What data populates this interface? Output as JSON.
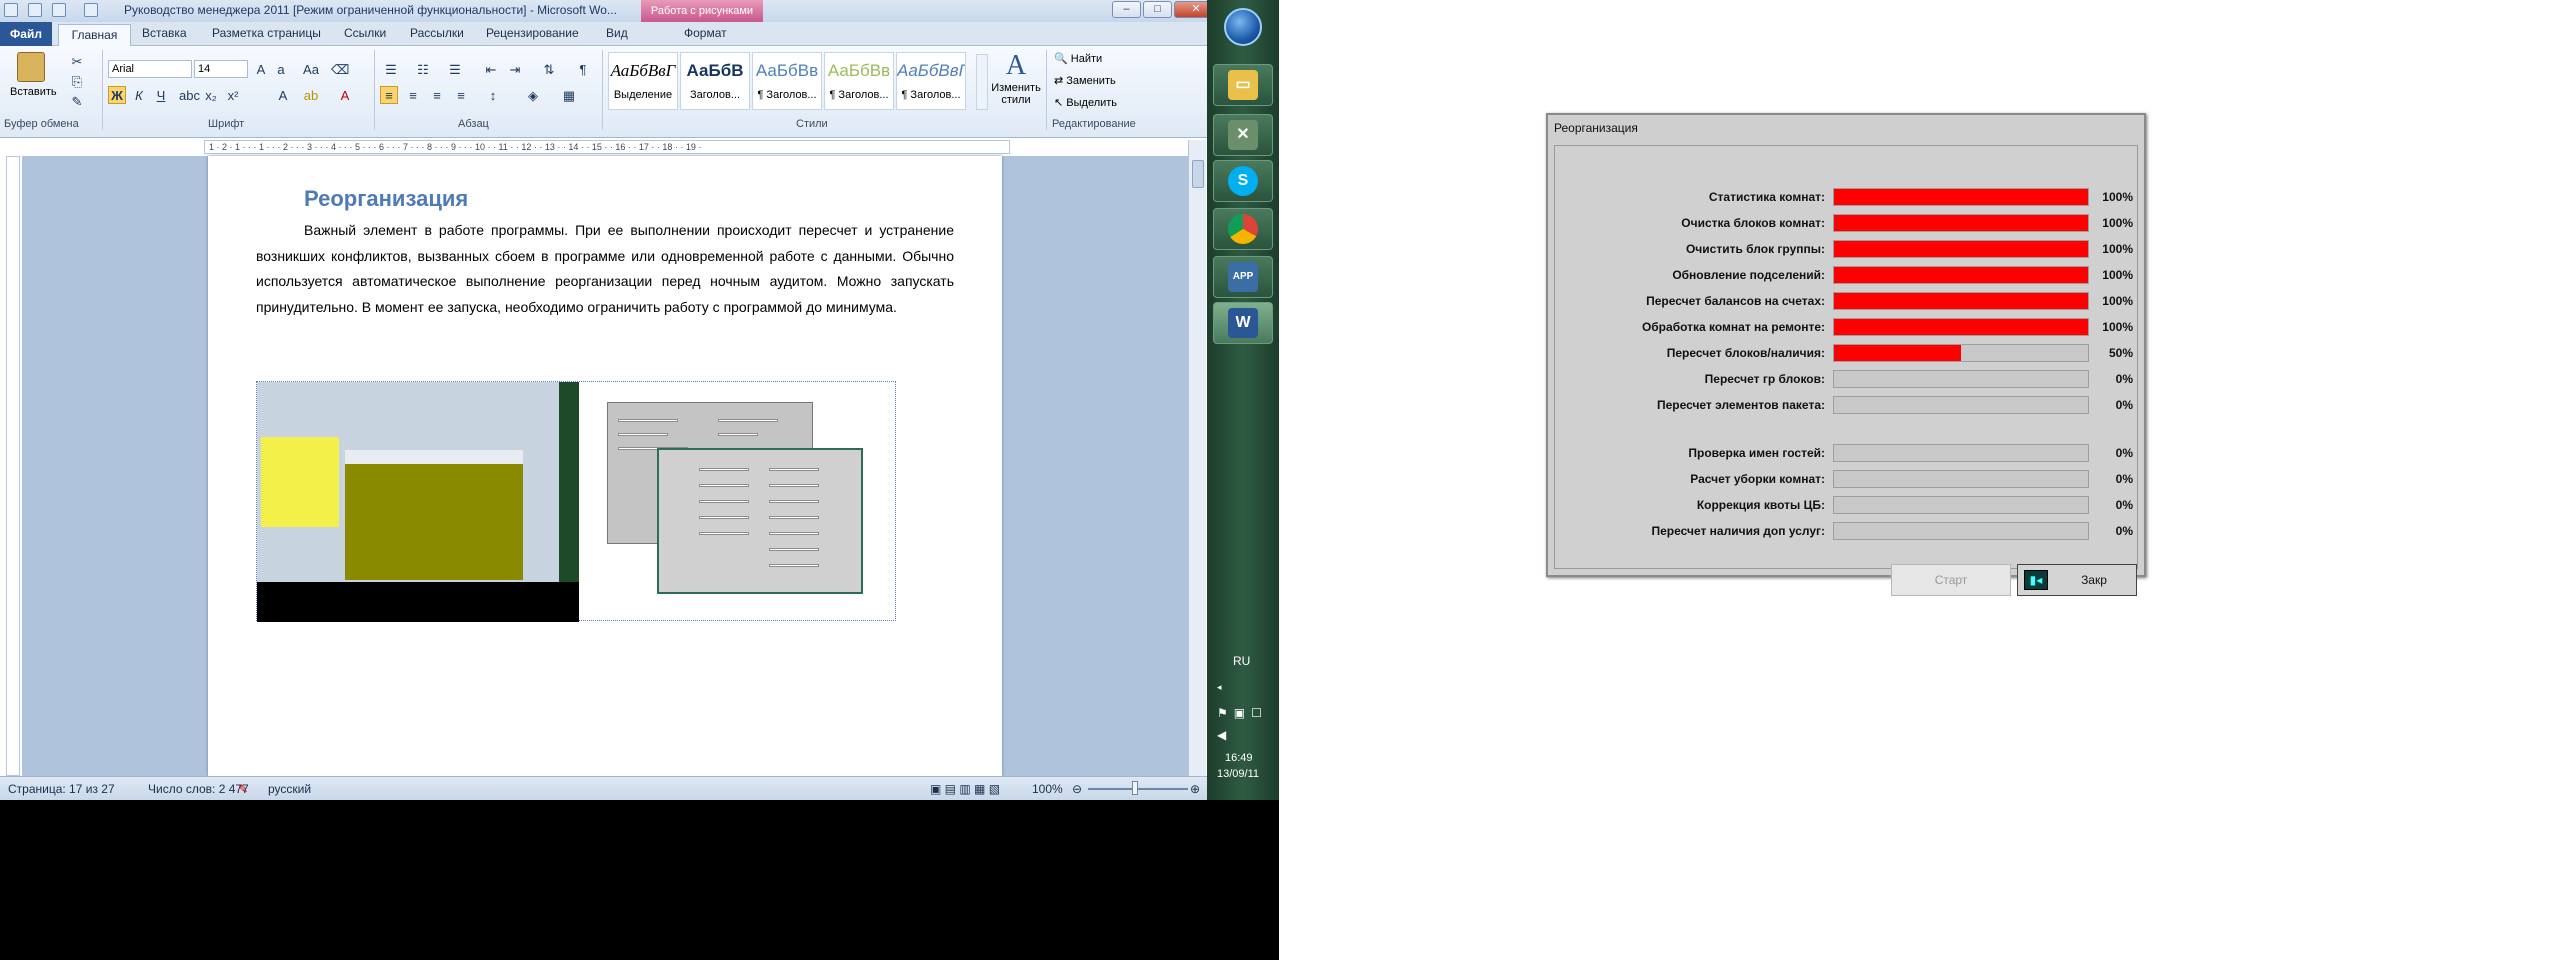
{
  "word": {
    "window_title": "Руководство менеджера 2011 [Режим ограниченной функциональности] - Microsoft Wo...",
    "pic_tools_tab": "Работа с рисунками",
    "tabs": [
      "Файл",
      "Главная",
      "Вставка",
      "Разметка страницы",
      "Ссылки",
      "Рассылки",
      "Рецензирование",
      "Вид",
      "Формат"
    ],
    "ribbon": {
      "paste": "Вставить",
      "clipboard": "Буфер обмена",
      "font_name": "Arial",
      "font_size": "14",
      "font_group": "Шрифт",
      "paragraph_group": "Абзац",
      "styles_group": "Стили",
      "editing_group": "Редактирование",
      "bold": "Ж",
      "italic": "К",
      "underline": "Ч",
      "styles": [
        {
          "sample": "АаБбВвГ",
          "name": "Выделение"
        },
        {
          "sample": "АаБбВ",
          "name": "Заголов..."
        },
        {
          "sample": "АаБбВв",
          "name": "¶ Заголов..."
        },
        {
          "sample": "АаБбВв",
          "name": "¶ Заголов..."
        },
        {
          "sample": "АаБбВвГ",
          "name": "¶ Заголов..."
        }
      ],
      "change_styles": "Изменить стили",
      "find": "Найти",
      "replace": "Заменить",
      "select": "Выделить"
    },
    "ruler_numbers": "1 · 2 · 1 · · · 1 · · · 2 · · · 3 · · · 4 · · · 5 · · · 6 · · · 7 · · · 8 · · · 9 · · · 10 · · 11 · · 12 · · 13 · · 14 · · 15 · · 16 · · 17 · · 18 · · 19 ·",
    "doc": {
      "heading": "Реорганизация",
      "body": "Важный элемент в работе программы. При ее выполнении происходит пересчет и устранение возникших конфликтов, вызванных сбоем в программе или одновременной работе с данными. Обычно используется автоматическое выполнение реорганизации перед ночным аудитом. Можно запускать принудительно. В момент ее запуска, необходимо ограничить работу с программой до минимума."
    },
    "status": {
      "page": "Страница: 17 из 27",
      "words": "Число слов: 2 477",
      "language": "русский",
      "zoom": "100%"
    }
  },
  "taskbar": {
    "lang": "RU",
    "time": "16:49",
    "date": "13/09/11",
    "apps": [
      "explorer",
      "tools",
      "skype",
      "chrome",
      "app",
      "word"
    ]
  },
  "dialog": {
    "title": "Реорганизация",
    "rows": [
      {
        "label": "Статистика комнат:",
        "pct_text": "100%",
        "fraction": 1.0
      },
      {
        "label": "Очистка блоков комнат:",
        "pct_text": "100%",
        "fraction": 1.0
      },
      {
        "label": "Очистить блок группы:",
        "pct_text": "100%",
        "fraction": 1.0
      },
      {
        "label": "Обновление подселений:",
        "pct_text": "100%",
        "fraction": 1.0
      },
      {
        "label": "Пересчет балансов на счетах:",
        "pct_text": "100%",
        "fraction": 1.0
      },
      {
        "label": "Обработка комнат на ремонте:",
        "pct_text": "100%",
        "fraction": 1.0
      },
      {
        "label": "Пересчет блоков/наличия:",
        "pct_text": "50%",
        "fraction": 0.5
      },
      {
        "label": "Пересчет гр блоков:",
        "pct_text": "0%",
        "fraction": 0.0
      },
      {
        "label": "Пересчет элементов пакета:",
        "pct_text": "0%",
        "fraction": 0.0
      },
      {
        "label": "Проверка имен гостей:",
        "pct_text": "0%",
        "fraction": 0.0
      },
      {
        "label": "Расчет уборки комнат:",
        "pct_text": "0%",
        "fraction": 0.0
      },
      {
        "label": "Коррекция квоты ЦБ:",
        "pct_text": "0%",
        "fraction": 0.0
      },
      {
        "label": "Пересчет наличия доп услуг:",
        "pct_text": "0%",
        "fraction": 0.0
      }
    ],
    "start_label": "Старт",
    "close_label": "Закр",
    "progress_color": "#ff0000"
  }
}
